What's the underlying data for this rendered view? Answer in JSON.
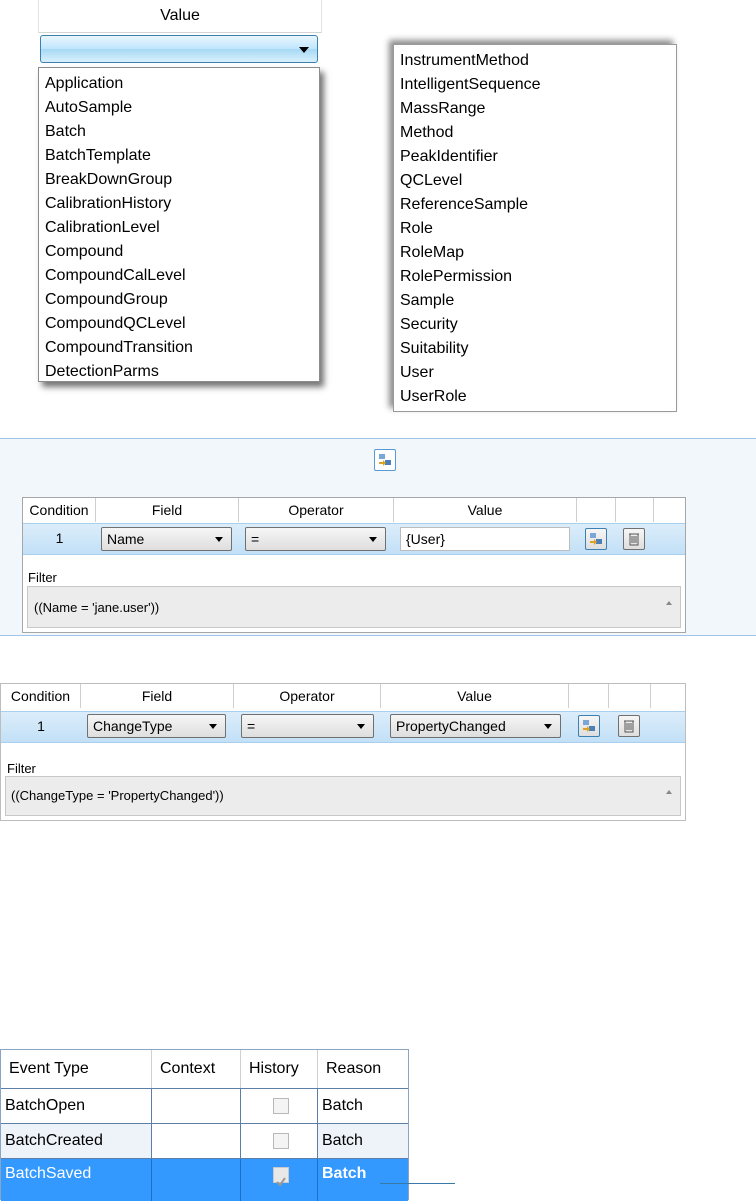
{
  "dropdown": {
    "header": "Value",
    "list1": [
      "Application",
      "AutoSample",
      "Batch",
      "BatchTemplate",
      "BreakDownGroup",
      "CalibrationHistory",
      "CalibrationLevel",
      "Compound",
      "CompoundCalLevel",
      "CompoundGroup",
      "CompoundQCLevel",
      "CompoundTransition",
      "DetectionParms"
    ],
    "list2": [
      "InstrumentMethod",
      "IntelligentSequence",
      "MassRange",
      "Method",
      "PeakIdentifier",
      "QCLevel",
      "ReferenceSample",
      "Role",
      "RoleMap",
      "RolePermission",
      "Sample",
      "Security",
      "Suitability",
      "User",
      "UserRole"
    ]
  },
  "filter1": {
    "headers": [
      "Condition",
      "Field",
      "Operator",
      "Value"
    ],
    "row": {
      "condition": "1",
      "field": "Name",
      "operator": "=",
      "value": "{User}"
    },
    "filter_label": "Filter",
    "filter_text": "((Name = 'jane.user'))"
  },
  "filter2": {
    "headers": [
      "Condition",
      "Field",
      "Operator",
      "Value"
    ],
    "row": {
      "condition": "1",
      "field": "ChangeType",
      "operator": "=",
      "value": "PropertyChanged"
    },
    "filter_label": "Filter",
    "filter_text": "((ChangeType = 'PropertyChanged'))"
  },
  "events": {
    "headers": [
      "Event Type",
      "Context",
      "History",
      "Reason"
    ],
    "rows": [
      {
        "event": "BatchOpen",
        "context": "",
        "history": false,
        "reason": "Batch"
      },
      {
        "event": "BatchCreated",
        "context": "",
        "history": false,
        "reason": "Batch"
      },
      {
        "event": "BatchSaved",
        "context": "",
        "history": true,
        "reason": "Batch"
      }
    ]
  },
  "colors": {
    "selection": "#3399ff",
    "accent": "#3c7fb1"
  },
  "icons": {
    "apply": "apply-filter-icon",
    "delete": "trash-icon",
    "dropdown": "chevron-down-icon"
  }
}
